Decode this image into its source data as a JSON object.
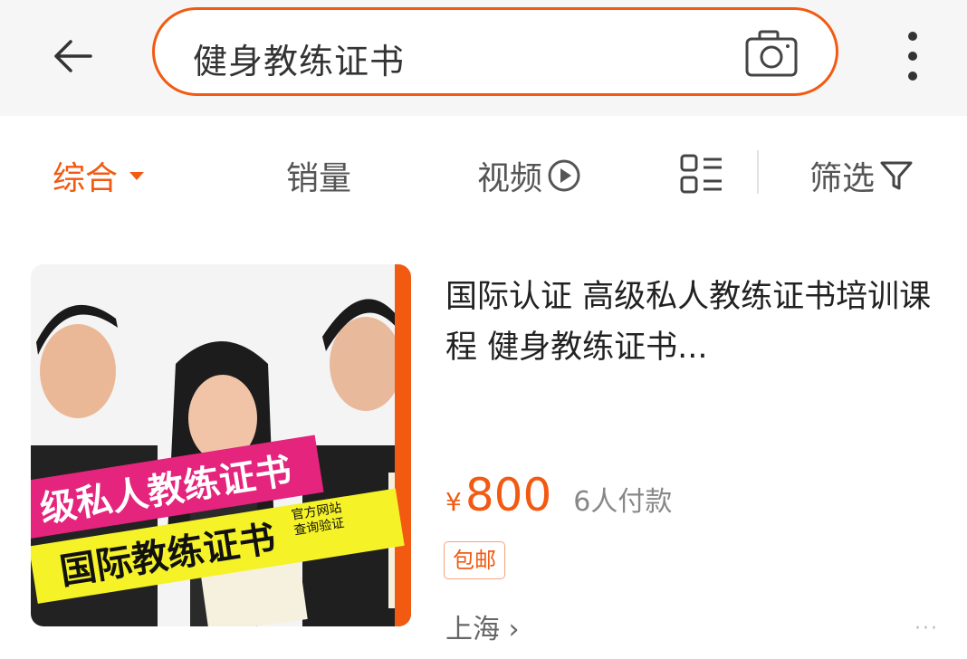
{
  "search": {
    "query": "健身教练证书"
  },
  "icons": {
    "back": "arrow-left-icon",
    "camera": "camera-icon",
    "more": "more-vertical-icon",
    "dropdown": "caret-down-icon",
    "play": "play-circle-icon",
    "layout": "list-layout-icon",
    "filter": "filter-funnel-icon"
  },
  "tabs": [
    {
      "label": "综合",
      "active": true
    },
    {
      "label": "销量"
    },
    {
      "label": "视频"
    },
    {
      "label": "筛选"
    }
  ],
  "product": {
    "title": "国际认证 高级私人教练证书培训课程 健身教练证书...",
    "price_symbol": "¥",
    "price": "800",
    "paid_count": "6人付款",
    "badge": "包邮",
    "location": "上海 ›",
    "more": "···",
    "image": {
      "banner_pink": "级私人教练证书",
      "banner_yellow": "国际教练证书",
      "stamp": "官方网站查询验证"
    }
  },
  "colors": {
    "accent": "#f25a12",
    "tab_text": "#555555",
    "banner_pink": "#e4247d",
    "banner_yellow": "#f5f227"
  }
}
